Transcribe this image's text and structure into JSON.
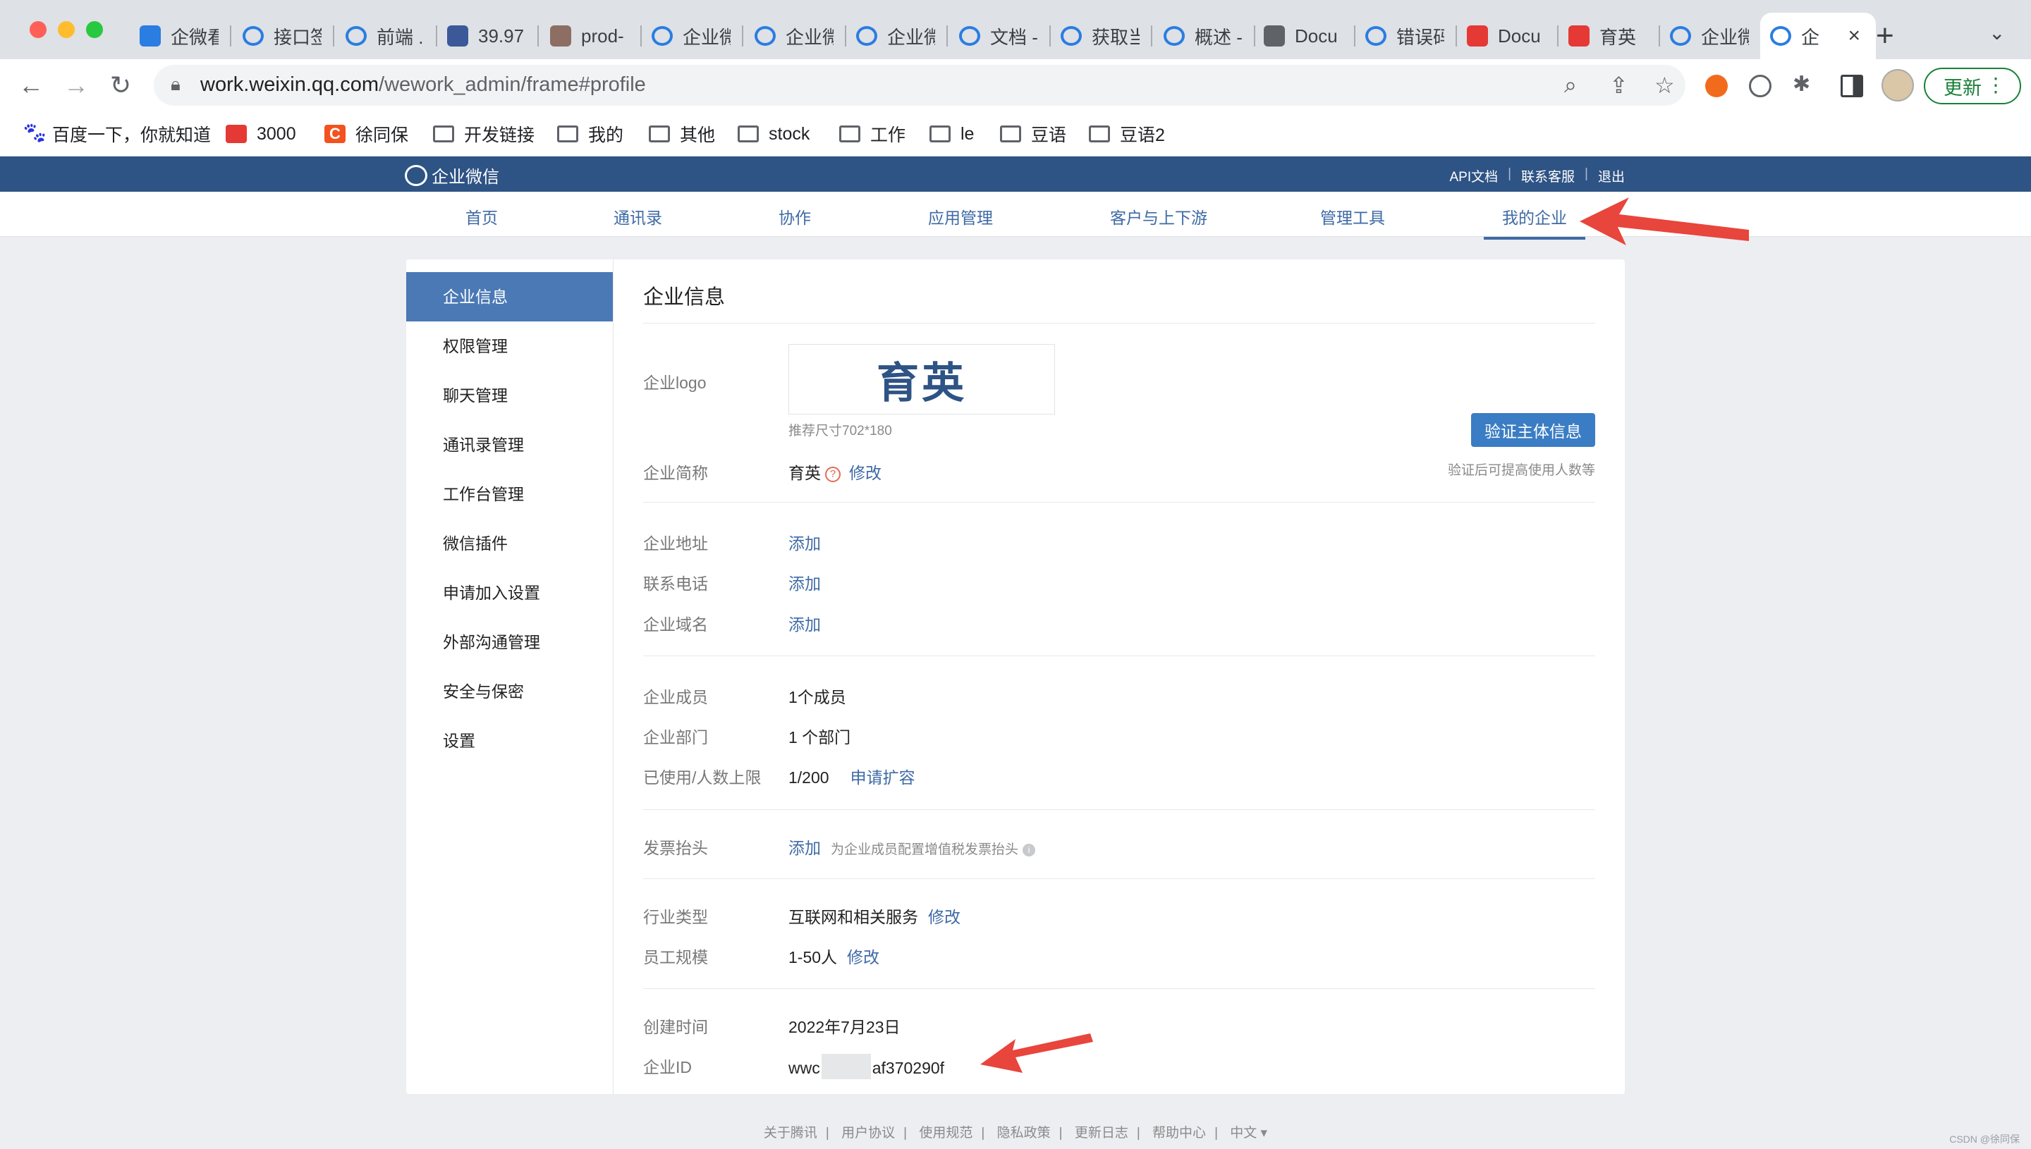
{
  "browser": {
    "tabs": [
      {
        "label": "企微看",
        "icon": "doc-icon",
        "color": "#2a7de1"
      },
      {
        "label": "接口签",
        "icon": "wechat-work-icon",
        "color": "#2a7de1"
      },
      {
        "label": "前端 .",
        "icon": "wechat-work-icon",
        "color": "#2a7de1"
      },
      {
        "label": "39.97",
        "icon": "server-icon",
        "color": "#3b5998"
      },
      {
        "label": "prod-",
        "icon": "jenkins-icon",
        "color": "#8d6e63"
      },
      {
        "label": "企业微",
        "icon": "wechat-work-icon",
        "color": "#2a7de1"
      },
      {
        "label": "企业微",
        "icon": "wechat-work-icon",
        "color": "#2a7de1"
      },
      {
        "label": "企业微",
        "icon": "wechat-work-icon",
        "color": "#2a7de1"
      },
      {
        "label": "文档 -",
        "icon": "wechat-work-icon",
        "color": "#2a7de1"
      },
      {
        "label": "获取当",
        "icon": "wechat-work-icon",
        "color": "#2a7de1"
      },
      {
        "label": "概述 -",
        "icon": "wechat-work-icon",
        "color": "#2a7de1"
      },
      {
        "label": "Docu",
        "icon": "globe-icon",
        "color": "#5f6368"
      },
      {
        "label": "错误码",
        "icon": "wechat-work-icon",
        "color": "#2a7de1"
      },
      {
        "label": "Docu",
        "icon": "book-icon",
        "color": "#e53935"
      },
      {
        "label": "育英",
        "icon": "book-icon",
        "color": "#e53935"
      },
      {
        "label": "企业微",
        "icon": "wechat-work-icon",
        "color": "#2a7de1"
      },
      {
        "label": "企",
        "icon": "wechat-work-icon",
        "color": "#2a7de1",
        "active": true
      }
    ],
    "url_host": "work.weixin.qq.com",
    "url_path": "/wework_admin/frame#profile",
    "update_label": "更新",
    "bookmarks": [
      {
        "label": "百度一下，你就知道",
        "icon": "baidu-icon"
      },
      {
        "label": "3000",
        "icon": "book-icon"
      },
      {
        "label": "徐同保",
        "icon": "csdn-icon"
      },
      {
        "label": "开发链接",
        "icon": "folder-icon"
      },
      {
        "label": "我的",
        "icon": "folder-icon"
      },
      {
        "label": "其他",
        "icon": "folder-icon"
      },
      {
        "label": "stock",
        "icon": "folder-icon"
      },
      {
        "label": "工作",
        "icon": "folder-icon"
      },
      {
        "label": "le",
        "icon": "folder-icon"
      },
      {
        "label": "豆语",
        "icon": "folder-icon"
      },
      {
        "label": "豆语2",
        "icon": "folder-icon"
      }
    ]
  },
  "app": {
    "brand": "企业微信",
    "top_links": [
      "API文档",
      "联系客服",
      "退出"
    ],
    "nav": [
      "首页",
      "通讯录",
      "协作",
      "应用管理",
      "客户与上下游",
      "管理工具",
      "我的企业"
    ],
    "active_nav": "我的企业",
    "sidebar": [
      "企业信息",
      "权限管理",
      "聊天管理",
      "通讯录管理",
      "工作台管理",
      "微信插件",
      "申请加入设置",
      "外部沟通管理",
      "安全与保密",
      "设置"
    ],
    "active_sidebar": "企业信息"
  },
  "profile": {
    "title": "企业信息",
    "logo_label": "企业logo",
    "logo_text": "育英",
    "logo_hint": "推荐尺寸702*180",
    "verify_button": "验证主体信息",
    "verify_hint": "验证后可提高使用人数等",
    "short_name_label": "企业简称",
    "short_name": "育英",
    "edit": "修改",
    "add": "添加",
    "address_label": "企业地址",
    "phone_label": "联系电话",
    "domain_label": "企业域名",
    "members_label": "企业成员",
    "members_value": "1个成员",
    "departments_label": "企业部门",
    "departments_value": "1 个部门",
    "limit_label": "已使用/人数上限",
    "limit_value": "1/200",
    "expand_link": "申请扩容",
    "invoice_label": "发票抬头",
    "invoice_note": "为企业成员配置增值税发票抬头",
    "industry_label": "行业类型",
    "industry_value": "互联网和相关服务",
    "staff_label": "员工规模",
    "staff_value": "1-50人",
    "created_label": "创建时间",
    "created_value": "2022年7月23日",
    "corpid_label": "企业ID",
    "corpid_prefix": "wwc",
    "corpid_suffix": "af370290f"
  },
  "footer": [
    "关于腾讯",
    "用户协议",
    "使用规范",
    "隐私政策",
    "更新日志",
    "帮助中心",
    "中文 ▾"
  ],
  "watermark": "CSDN @徐同保",
  "colors": {
    "topbar": "#2e5385",
    "accent": "#3e6aa5",
    "sidebar_active": "#4a79b5",
    "annotation_arrow": "#e8453c"
  }
}
